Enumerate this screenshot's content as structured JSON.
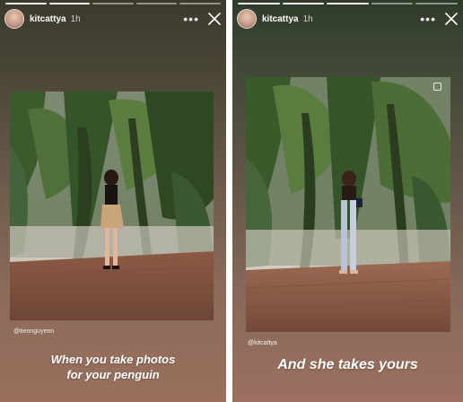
{
  "stories": [
    {
      "username": "kitcattya",
      "time": "1h",
      "more_label": "•••",
      "photo_credit": "@tiennguyenn",
      "caption_line1": "When you take photos",
      "caption_line2": "for your penguin"
    },
    {
      "username": "kitcattya",
      "time": "1h",
      "more_label": "•••",
      "photo_credit": "@kitcattya",
      "caption_line1": "And she takes yours"
    }
  ],
  "icons": {
    "close": "close-icon",
    "more": "more-options-icon",
    "avatar": "avatar"
  },
  "colors": {
    "text": "#ffffff",
    "foliage": "#3e5a2f",
    "ground": "#8b5a45"
  }
}
